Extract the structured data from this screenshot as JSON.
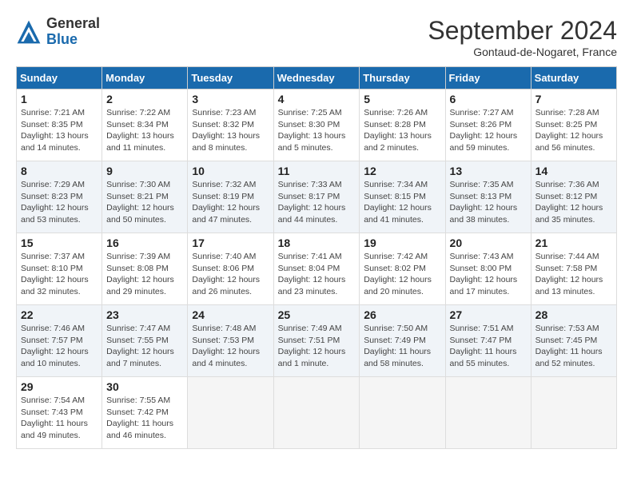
{
  "logo": {
    "general": "General",
    "blue": "Blue"
  },
  "title": "September 2024",
  "subtitle": "Gontaud-de-Nogaret, France",
  "days_of_week": [
    "Sunday",
    "Monday",
    "Tuesday",
    "Wednesday",
    "Thursday",
    "Friday",
    "Saturday"
  ],
  "weeks": [
    [
      {
        "day": "1",
        "info": "Sunrise: 7:21 AM\nSunset: 8:35 PM\nDaylight: 13 hours and 14 minutes."
      },
      {
        "day": "2",
        "info": "Sunrise: 7:22 AM\nSunset: 8:34 PM\nDaylight: 13 hours and 11 minutes."
      },
      {
        "day": "3",
        "info": "Sunrise: 7:23 AM\nSunset: 8:32 PM\nDaylight: 13 hours and 8 minutes."
      },
      {
        "day": "4",
        "info": "Sunrise: 7:25 AM\nSunset: 8:30 PM\nDaylight: 13 hours and 5 minutes."
      },
      {
        "day": "5",
        "info": "Sunrise: 7:26 AM\nSunset: 8:28 PM\nDaylight: 13 hours and 2 minutes."
      },
      {
        "day": "6",
        "info": "Sunrise: 7:27 AM\nSunset: 8:26 PM\nDaylight: 12 hours and 59 minutes."
      },
      {
        "day": "7",
        "info": "Sunrise: 7:28 AM\nSunset: 8:25 PM\nDaylight: 12 hours and 56 minutes."
      }
    ],
    [
      {
        "day": "8",
        "info": "Sunrise: 7:29 AM\nSunset: 8:23 PM\nDaylight: 12 hours and 53 minutes."
      },
      {
        "day": "9",
        "info": "Sunrise: 7:30 AM\nSunset: 8:21 PM\nDaylight: 12 hours and 50 minutes."
      },
      {
        "day": "10",
        "info": "Sunrise: 7:32 AM\nSunset: 8:19 PM\nDaylight: 12 hours and 47 minutes."
      },
      {
        "day": "11",
        "info": "Sunrise: 7:33 AM\nSunset: 8:17 PM\nDaylight: 12 hours and 44 minutes."
      },
      {
        "day": "12",
        "info": "Sunrise: 7:34 AM\nSunset: 8:15 PM\nDaylight: 12 hours and 41 minutes."
      },
      {
        "day": "13",
        "info": "Sunrise: 7:35 AM\nSunset: 8:13 PM\nDaylight: 12 hours and 38 minutes."
      },
      {
        "day": "14",
        "info": "Sunrise: 7:36 AM\nSunset: 8:12 PM\nDaylight: 12 hours and 35 minutes."
      }
    ],
    [
      {
        "day": "15",
        "info": "Sunrise: 7:37 AM\nSunset: 8:10 PM\nDaylight: 12 hours and 32 minutes."
      },
      {
        "day": "16",
        "info": "Sunrise: 7:39 AM\nSunset: 8:08 PM\nDaylight: 12 hours and 29 minutes."
      },
      {
        "day": "17",
        "info": "Sunrise: 7:40 AM\nSunset: 8:06 PM\nDaylight: 12 hours and 26 minutes."
      },
      {
        "day": "18",
        "info": "Sunrise: 7:41 AM\nSunset: 8:04 PM\nDaylight: 12 hours and 23 minutes."
      },
      {
        "day": "19",
        "info": "Sunrise: 7:42 AM\nSunset: 8:02 PM\nDaylight: 12 hours and 20 minutes."
      },
      {
        "day": "20",
        "info": "Sunrise: 7:43 AM\nSunset: 8:00 PM\nDaylight: 12 hours and 17 minutes."
      },
      {
        "day": "21",
        "info": "Sunrise: 7:44 AM\nSunset: 7:58 PM\nDaylight: 12 hours and 13 minutes."
      }
    ],
    [
      {
        "day": "22",
        "info": "Sunrise: 7:46 AM\nSunset: 7:57 PM\nDaylight: 12 hours and 10 minutes."
      },
      {
        "day": "23",
        "info": "Sunrise: 7:47 AM\nSunset: 7:55 PM\nDaylight: 12 hours and 7 minutes."
      },
      {
        "day": "24",
        "info": "Sunrise: 7:48 AM\nSunset: 7:53 PM\nDaylight: 12 hours and 4 minutes."
      },
      {
        "day": "25",
        "info": "Sunrise: 7:49 AM\nSunset: 7:51 PM\nDaylight: 12 hours and 1 minute."
      },
      {
        "day": "26",
        "info": "Sunrise: 7:50 AM\nSunset: 7:49 PM\nDaylight: 11 hours and 58 minutes."
      },
      {
        "day": "27",
        "info": "Sunrise: 7:51 AM\nSunset: 7:47 PM\nDaylight: 11 hours and 55 minutes."
      },
      {
        "day": "28",
        "info": "Sunrise: 7:53 AM\nSunset: 7:45 PM\nDaylight: 11 hours and 52 minutes."
      }
    ],
    [
      {
        "day": "29",
        "info": "Sunrise: 7:54 AM\nSunset: 7:43 PM\nDaylight: 11 hours and 49 minutes."
      },
      {
        "day": "30",
        "info": "Sunrise: 7:55 AM\nSunset: 7:42 PM\nDaylight: 11 hours and 46 minutes."
      },
      {
        "day": "",
        "info": ""
      },
      {
        "day": "",
        "info": ""
      },
      {
        "day": "",
        "info": ""
      },
      {
        "day": "",
        "info": ""
      },
      {
        "day": "",
        "info": ""
      }
    ]
  ]
}
